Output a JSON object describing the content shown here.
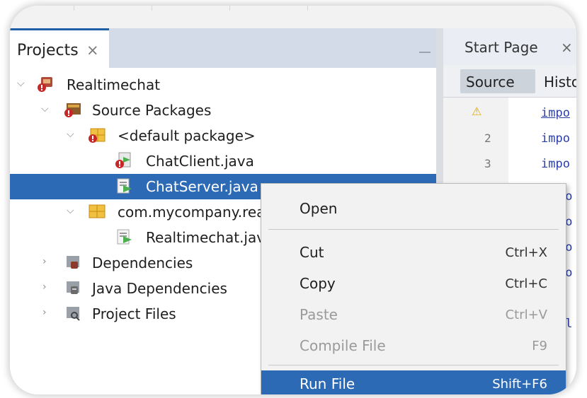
{
  "projects_panel": {
    "tab_label": "Projects",
    "close_glyph": "×",
    "tree": [
      {
        "label": "Realtimechat",
        "icon": "project-icon"
      },
      {
        "label": "Source Packages",
        "icon": "source-packages-icon"
      },
      {
        "label": "<default package>",
        "icon": "package-icon"
      },
      {
        "label": "ChatClient.java",
        "icon": "java-file-error-icon"
      },
      {
        "label": "ChatServer.java",
        "icon": "java-file-icon",
        "selected": true
      },
      {
        "label": "com.mycompany.realtimechat",
        "icon": "package-icon"
      },
      {
        "label": "Realtimechat.java",
        "icon": "java-file-icon"
      },
      {
        "label": "Dependencies",
        "icon": "dependencies-icon"
      },
      {
        "label": "Java Dependencies",
        "icon": "java-dependencies-icon"
      },
      {
        "label": "Project Files",
        "icon": "project-files-icon"
      }
    ]
  },
  "editor": {
    "tab_label": "Start Page",
    "close_glyph": "×",
    "source_label": "Source",
    "history_label": "History",
    "line_numbers": [
      "2",
      "3"
    ],
    "code_lines": [
      "impo",
      "impo",
      "impo",
      "po",
      "po",
      "po",
      "po",
      "bl"
    ]
  },
  "context_menu": {
    "items": [
      {
        "label": "Open",
        "shortcut": ""
      },
      {
        "label": "Cut",
        "shortcut": "Ctrl+X"
      },
      {
        "label": "Copy",
        "shortcut": "Ctrl+C"
      },
      {
        "label": "Paste",
        "shortcut": "Ctrl+V"
      },
      {
        "label": "Compile File",
        "shortcut": "F9"
      },
      {
        "label": "Run File",
        "shortcut": "Shift+F6"
      }
    ]
  },
  "colors": {
    "selection": "#2d6ab6",
    "panel_header": "#d3dbe8",
    "menu_bg": "#f2f2f2",
    "code_keyword": "#2a3ea8"
  }
}
